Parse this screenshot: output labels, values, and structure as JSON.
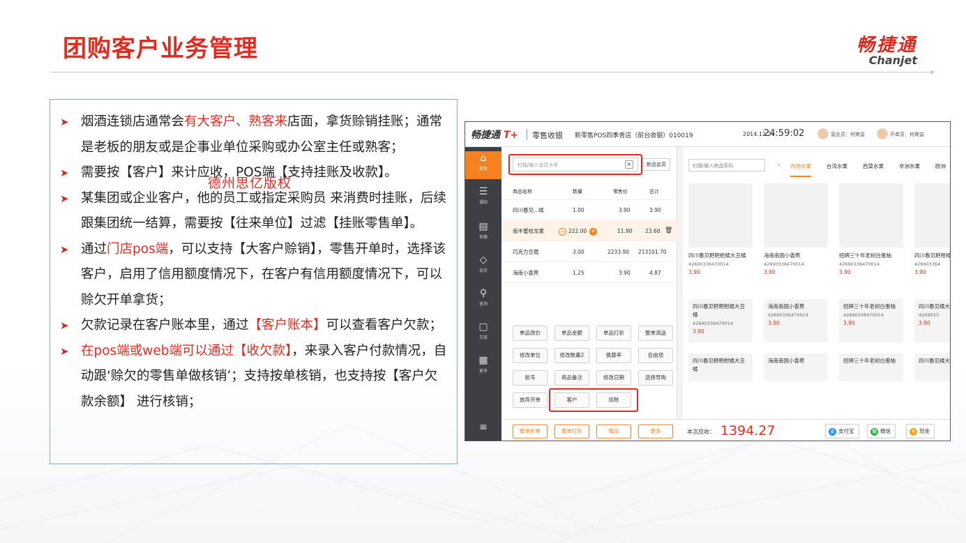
{
  "slide": {
    "title": "团购客户业务管理",
    "logo_cn": "畅捷通",
    "logo_en": "Chanjet",
    "watermark": "德州思亿版权"
  },
  "bullets": [
    {
      "parts": [
        {
          "t": "烟酒连锁店通常会"
        },
        {
          "t": "有大客户、熟客来",
          "red": true
        },
        {
          "t": "店面，拿货赊销挂账；通常是老板的朋友或是企事业单位采购或办公室主任或熟客；"
        }
      ]
    },
    {
      "parts": [
        {
          "t": "需要按【客户】来计应收，POS端【支持挂账及收款】。"
        }
      ]
    },
    {
      "parts": [
        {
          "t": "某集团或企业客户，他的员工或指定采购员 来消费时挂账，后续跟集团统一结算，需要按【往来单位】过滤【挂账零售单】。"
        }
      ]
    },
    {
      "parts": [
        {
          "t": "通过"
        },
        {
          "t": "门店pos端",
          "red": true
        },
        {
          "t": "，可以支持【大客户赊销】，零售开单时，选择该客户，启用了信用额度情况下，在客户有信用额度情况下，可以赊欠开单拿货；"
        }
      ]
    },
    {
      "parts": [
        {
          "t": "欠款记录在客户账本里，通过"
        },
        {
          "t": "【客户账本】",
          "red": true
        },
        {
          "t": "可以查看客户欠款；"
        }
      ]
    },
    {
      "parts": [
        {
          "t": "在pos端或web端可以通过【收欠款】",
          "red": true
        },
        {
          "t": "，来录入客户付款情况，自动跟‘赊欠的零售单做核销’；支持按单核销，也支持按【客户欠款余额】 进行核销；"
        }
      ]
    }
  ],
  "pos": {
    "brand": "畅捷通",
    "brand_tplus": "T+",
    "module": "零售收银",
    "store": "新零售POS四季青店（前台收银）010019",
    "date": "2014.12.24",
    "clock": "24:59:02",
    "user1": "营业员：何爽益",
    "user2": "开单员：何爽益",
    "sidebar": [
      "首页",
      "通知",
      "单据",
      "会员",
      "查询",
      "交班",
      "更多"
    ],
    "search_placeholder": "扫描/输入会员卡号",
    "member_button": "新品会员",
    "table_headers": [
      "商品名称",
      "数量",
      "零售价",
      "总计"
    ],
    "rows": [
      {
        "name": "四川春见...橘",
        "qty": "1.00",
        "price": "3.90",
        "total": "3.90"
      },
      {
        "name": "南丰蜜桔龙果",
        "qty": "222.00",
        "price": "11.90",
        "total": "23.60"
      },
      {
        "name": "巧克力豆蔻",
        "qty": "3.00",
        "price": "2233.90",
        "total": "213101.70"
      },
      {
        "name": "海南小香蕉",
        "qty": "1.25",
        "price": "3.90",
        "total": "4.87"
      }
    ],
    "function_buttons": [
      [
        "单品改价",
        "单品金额",
        "单品打折",
        "整单清送"
      ],
      [
        "修改单位",
        "修改数量2",
        "换算率",
        "自由项"
      ],
      [
        "批号",
        "商品备注",
        "修改日期",
        "选择导购"
      ],
      [
        "放弃开单",
        "客户",
        "挂账",
        ""
      ]
    ],
    "bottom_buttons": [
      "整单折零",
      "整单打折",
      "赠品",
      "更多"
    ],
    "amount_label": "本次应收：",
    "amount": "1394.27",
    "pay_methods": [
      "支付宝",
      "微信",
      "现金"
    ],
    "product_search": "扫描/输入商品条码",
    "categories": [
      "内地水果",
      "台湾水果",
      "西菜水果",
      "非洲水果",
      "欧洲"
    ],
    "products_row1": [
      {
        "name": "四川春见粑粑柑橘大丑橘",
        "code": "4269033647001​4",
        "price": "3.90"
      },
      {
        "name": "海南南国小香蕉",
        "code": "4269033647001​4",
        "price": "3.90"
      },
      {
        "name": "招牌三十年老树白蛋柚",
        "code": "4269033647001​4",
        "price": "3.90"
      },
      {
        "name": "四川春见粑柑橘",
        "code": "426903364",
        "price": "3.90"
      }
    ],
    "products_row2": [
      {
        "name": "四川春见粑粑柑橘大丑橘",
        "code": "42690336470014",
        "price": "3.90"
      },
      {
        "name": "海南南国小香蕉",
        "code": "42690336470014",
        "price": "3.90"
      },
      {
        "name": "招牌三十年老树白蛋柚",
        "code": "42690336470014",
        "price": "3.90"
      },
      {
        "name": "四川春见橘大丑橘",
        "code": "4269033",
        "price": "3.90"
      }
    ],
    "products_row3": [
      {
        "name": "四川春见粑粑柑橘大丑橘"
      },
      {
        "name": "海南南国小香蕉"
      },
      {
        "name": "招牌三十年老树白蛋柚"
      },
      {
        "name": "四川春见橘大丑橘"
      }
    ]
  }
}
